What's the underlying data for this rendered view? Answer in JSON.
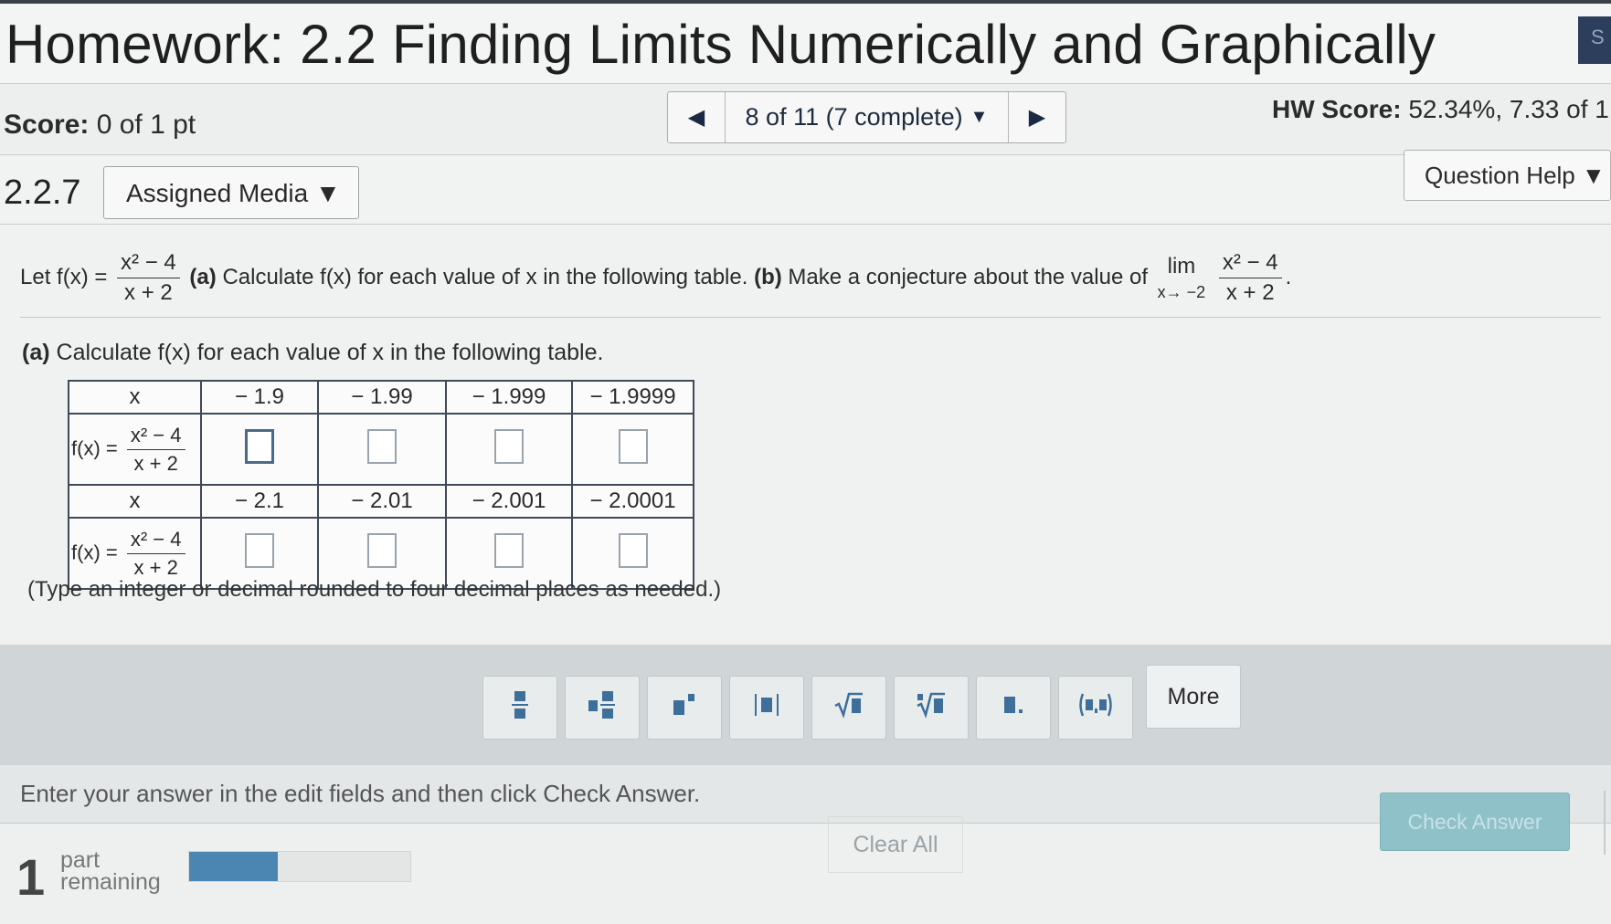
{
  "header": {
    "title": "Homework: 2.2 Finding Limits Numerically and Graphically",
    "corner_label": "S"
  },
  "score_bar": {
    "score_label": "Score:",
    "score_value": "0 of 1 pt",
    "nav_text": "8 of 11 (7 complete)",
    "hw_score_label": "HW Score:",
    "hw_score_value": "52.34%, 7.33 of 1"
  },
  "question_bar": {
    "number": "2.2.7",
    "media_label": "Assigned Media",
    "help_label": "Question Help"
  },
  "statement": {
    "let": "Let f(x) =",
    "num": "x² − 4",
    "den": "x + 2",
    "part_a": "(a)",
    "part_a_text": "Calculate f(x) for each value of x in the following table.",
    "part_b": "(b)",
    "part_b_text": "Make a conjecture about the value of",
    "lim": "lim",
    "lim_sub": "x→ −2",
    "lim_num": "x² − 4",
    "lim_den": "x + 2"
  },
  "part_a_heading": {
    "label": "(a)",
    "text": "Calculate f(x) for each value of x in the following table."
  },
  "table": {
    "x_label": "x",
    "f_label": "f(x) =",
    "f_num": "x² − 4",
    "f_den": "x + 2",
    "row1_x": [
      "− 1.9",
      "− 1.99",
      "− 1.999",
      "− 1.9999"
    ],
    "row2_x": [
      "− 2.1",
      "− 2.01",
      "− 2.001",
      "− 2.0001"
    ]
  },
  "hint": "(Type an integer or decimal rounded to four decimal places as needed.)",
  "toolbar": {
    "more_label": "More"
  },
  "instruction": "Enter your answer in the edit fields and then click Check Answer.",
  "footer": {
    "parts_remaining": "1",
    "part_word": "part",
    "remaining_word": "remaining",
    "progress": 0.4,
    "clear_label": "Clear All",
    "check_label": "Check Answer"
  }
}
